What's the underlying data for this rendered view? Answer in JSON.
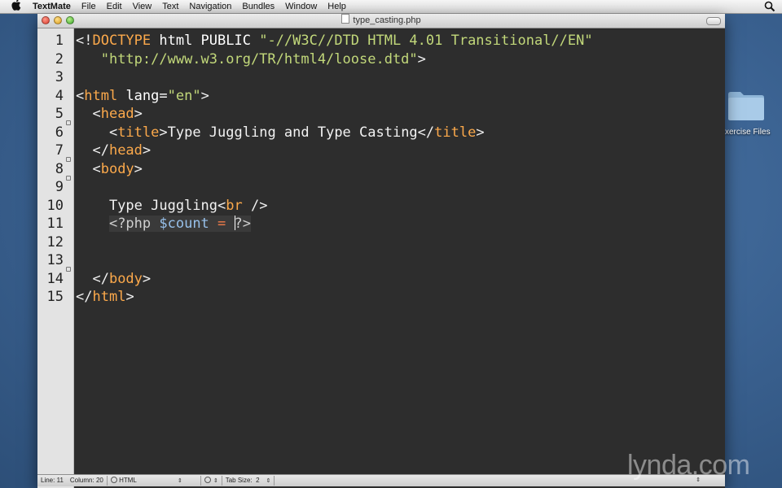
{
  "menubar": {
    "app_name": "TextMate",
    "items": [
      "File",
      "Edit",
      "View",
      "Text",
      "Navigation",
      "Bundles",
      "Window",
      "Help"
    ]
  },
  "window": {
    "title": "type_casting.php"
  },
  "editor": {
    "line_numbers": [
      "1",
      "2",
      "3",
      "4",
      "5",
      "6",
      "7",
      "8",
      "9",
      "10",
      "11",
      "12",
      "13",
      "14",
      "15"
    ],
    "lines": {
      "l1": {
        "a": "<!",
        "b": "DOCTYPE",
        "c": " html PUBLIC ",
        "d": "\"-//W3C//DTD HTML 4.01 Transitional//EN\""
      },
      "l2": {
        "a": "   ",
        "b": "\"http://www.w3.org/TR/html4/loose.dtd\"",
        "c": ">"
      },
      "l4": {
        "a": "<",
        "b": "html",
        "c": " lang=",
        "d": "\"en\"",
        "e": ">"
      },
      "l5": {
        "a": "  <",
        "b": "head",
        "c": ">"
      },
      "l6": {
        "a": "    <",
        "b": "title",
        "c": ">",
        "d": "Type Juggling and Type Casting",
        "e": "</",
        "f": "title",
        "g": ">"
      },
      "l7": {
        "a": "  </",
        "b": "head",
        "c": ">"
      },
      "l8": {
        "a": "  <",
        "b": "body",
        "c": ">"
      },
      "l10": {
        "a": "    Type Juggling",
        "b": "<",
        "c": "br",
        "d": " />"
      },
      "l11": {
        "a": "    ",
        "b": "<?php ",
        "c": "$count",
        "d": " ",
        "e": "=",
        "f": " ",
        "g": "?>"
      },
      "l13": {
        "a": "  </",
        "b": "body",
        "c": ">"
      },
      "l14": {
        "a": "</",
        "b": "html",
        "c": ">"
      }
    }
  },
  "statusbar": {
    "line_label": "Line:",
    "line_value": "11",
    "column_label": "Column:",
    "column_value": "20",
    "language": "HTML",
    "tab_size_label": "Tab Size:",
    "tab_size_value": "2"
  },
  "desktop": {
    "folder_label": "xercise Files"
  },
  "watermark": "lynda.com"
}
